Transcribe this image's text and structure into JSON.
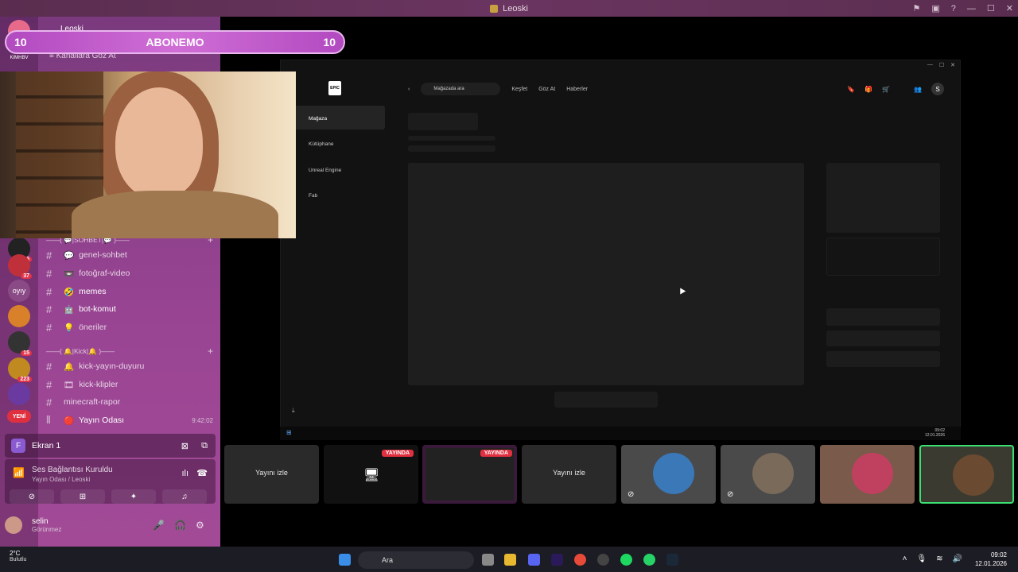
{
  "window": {
    "title": "Leoski"
  },
  "banner": {
    "left": "10",
    "text": "ABONEMO",
    "right": "10"
  },
  "server_header": {
    "name": "Leoski",
    "browse": "Kanallara Göz At"
  },
  "servers": [
    {
      "label": "KIMHBV",
      "badge": ""
    },
    {
      "label": "",
      "badge": "6"
    },
    {
      "label": "",
      "badge": "37"
    },
    {
      "label": "oyıy",
      "badge": ""
    },
    {
      "label": "",
      "badge": ""
    },
    {
      "label": "",
      "badge": "15"
    },
    {
      "label": "",
      "badge": "223"
    },
    {
      "label": "",
      "badge": ""
    },
    {
      "label": "YENİ",
      "badge": ""
    }
  ],
  "categories": {
    "sohbet": "——( 💬|SOHBET|💬 )——",
    "kick": "——( 🔔|Kick|🔔 )——"
  },
  "channels": [
    {
      "name": "genel-sohbet",
      "emoji": "💬"
    },
    {
      "name": "fotoğraf-video",
      "emoji": "📼"
    },
    {
      "name": "memes",
      "emoji": "🤣"
    },
    {
      "name": "bot-komut",
      "emoji": "🤖"
    },
    {
      "name": "öneriler",
      "emoji": "💡"
    },
    {
      "name": "kick-yayın-duyuru",
      "emoji": "🔔"
    },
    {
      "name": "kick-klipler",
      "emoji": "🎞"
    },
    {
      "name": "minecraft-rapor",
      "emoji": ""
    },
    {
      "name": "Yayın Odası",
      "emoji": "🔴",
      "time": "9:42:02"
    }
  ],
  "screen": {
    "label": "Ekran 1",
    "initial": "F"
  },
  "voice": {
    "status": "Ses Bağlantısı Kuruldu",
    "room": "Yayın Odası / Leoski"
  },
  "user": {
    "name": "selin",
    "status": "Görünmez"
  },
  "weather": {
    "temp": "2°C",
    "cond": "Bulutlu"
  },
  "epic": {
    "logo": "EPIC",
    "search_placeholder": "Mağazada ara",
    "nav": [
      "Keşfet",
      "Göz At",
      "Haberler"
    ],
    "sidebar": [
      "Mağaza",
      "Kütüphane",
      "Unreal Engine",
      "Fab"
    ],
    "user_initial": "S",
    "inner_clock": {
      "time": "09:02",
      "date": "12.01.2026"
    }
  },
  "tiles": [
    {
      "label": "Yayını izle",
      "live": ""
    },
    {
      "label": "",
      "live": "YAYINDA"
    },
    {
      "label": "",
      "live": "YAYINDA"
    },
    {
      "label": "Yayını izle",
      "live": ""
    },
    {
      "label": "",
      "live": ""
    },
    {
      "label": "",
      "live": ""
    },
    {
      "label": "",
      "live": ""
    },
    {
      "label": "",
      "live": ""
    }
  ],
  "taskbar": {
    "search": "Ara",
    "time": "09:02",
    "date": "12.01.2026"
  },
  "colors": {
    "accent": "#9a4594",
    "live": "#e03040",
    "epic_bg": "#121212"
  }
}
